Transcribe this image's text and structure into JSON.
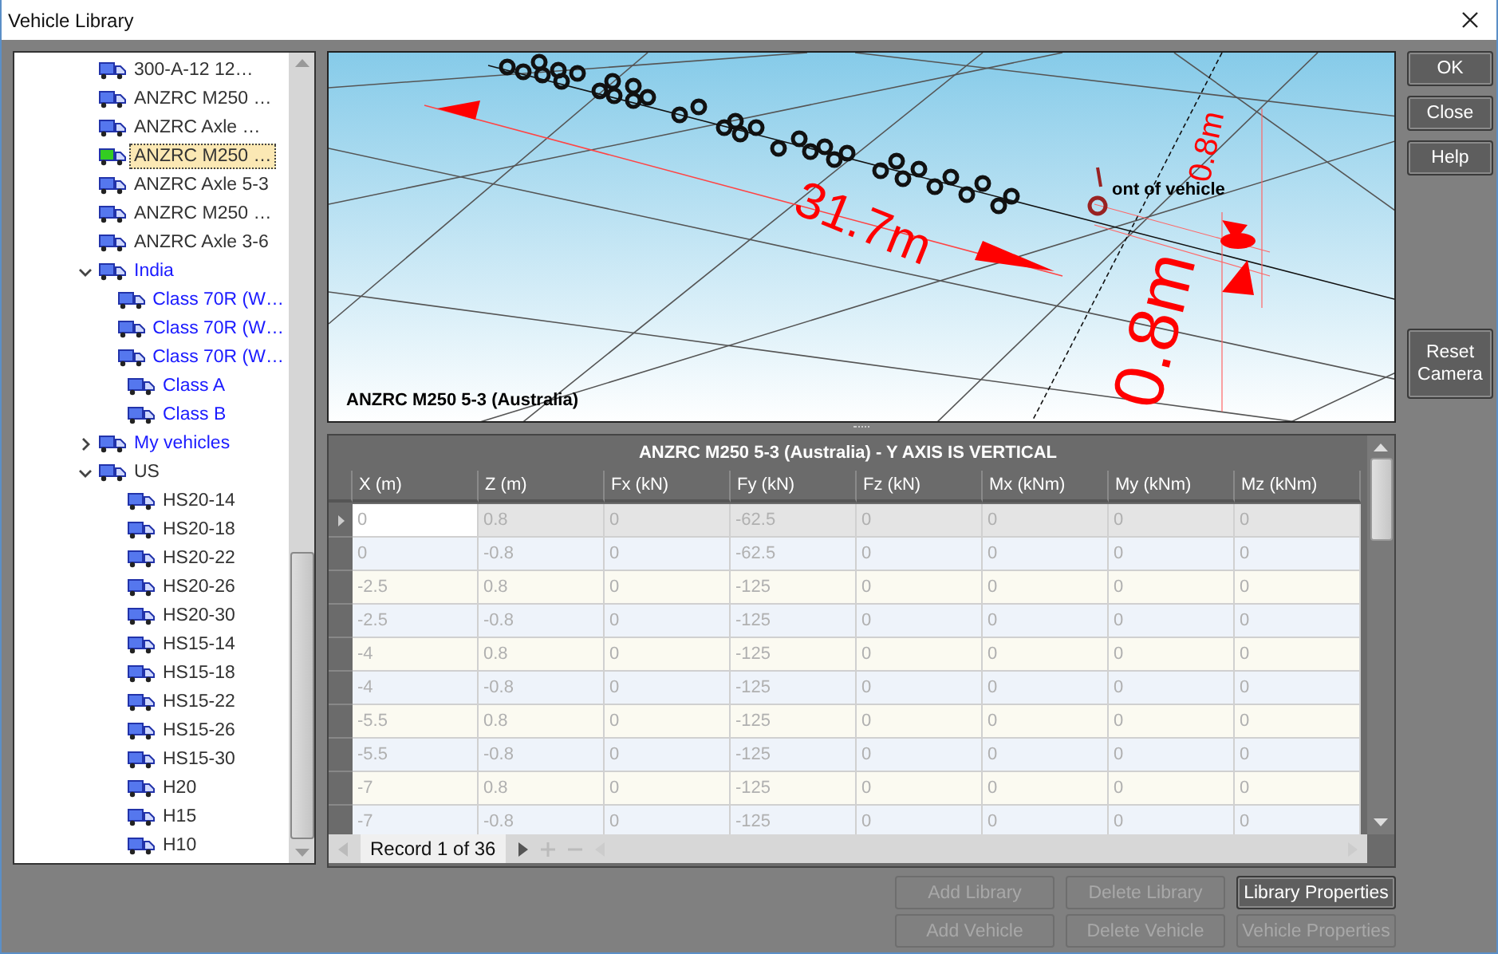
{
  "window": {
    "title": "Vehicle Library"
  },
  "tree": {
    "items": [
      {
        "kind": "group",
        "color": "#333333",
        "children": [
          {
            "kind": "vehicle",
            "label": "300-A-12 12…",
            "selected": false
          },
          {
            "kind": "vehicle",
            "label": "ANZRC M250 …",
            "selected": false
          },
          {
            "kind": "vehicle",
            "label": "ANZRC Axle …",
            "selected": false
          },
          {
            "kind": "vehicle",
            "label": "ANZRC M250 …",
            "selected": true
          },
          {
            "kind": "vehicle",
            "label": "ANZRC Axle 5-3",
            "selected": false
          },
          {
            "kind": "vehicle",
            "label": "ANZRC M250 …",
            "selected": false
          },
          {
            "kind": "vehicle",
            "label": "ANZRC Axle 3-6",
            "selected": false
          }
        ]
      },
      {
        "kind": "group",
        "label": "India",
        "color": "#1a1aff",
        "expanded": true,
        "children": [
          {
            "kind": "vehicle",
            "label": "Class 70R (W…",
            "selected": false
          },
          {
            "kind": "vehicle",
            "label": "Class 70R (W…",
            "selected": false
          },
          {
            "kind": "vehicle",
            "label": "Class 70R (W…",
            "selected": false
          },
          {
            "kind": "vehicle",
            "label": "Class A",
            "selected": false
          },
          {
            "kind": "vehicle",
            "label": "Class B",
            "selected": false
          }
        ]
      },
      {
        "kind": "group",
        "label": "My vehicles",
        "color": "#1a1aff",
        "expanded": false
      },
      {
        "kind": "group",
        "label": "US",
        "color": "#333333",
        "expanded": true,
        "children": [
          {
            "kind": "vehicle",
            "label": "HS20-14",
            "selected": false
          },
          {
            "kind": "vehicle",
            "label": "HS20-18",
            "selected": false
          },
          {
            "kind": "vehicle",
            "label": "HS20-22",
            "selected": false
          },
          {
            "kind": "vehicle",
            "label": "HS20-26",
            "selected": false
          },
          {
            "kind": "vehicle",
            "label": "HS20-30",
            "selected": false
          },
          {
            "kind": "vehicle",
            "label": "HS15-14",
            "selected": false
          },
          {
            "kind": "vehicle",
            "label": "HS15-18",
            "selected": false
          },
          {
            "kind": "vehicle",
            "label": "HS15-22",
            "selected": false
          },
          {
            "kind": "vehicle",
            "label": "HS15-26",
            "selected": false
          },
          {
            "kind": "vehicle",
            "label": "HS15-30",
            "selected": false
          },
          {
            "kind": "vehicle",
            "label": "H20",
            "selected": false
          },
          {
            "kind": "vehicle",
            "label": "H15",
            "selected": false
          },
          {
            "kind": "vehicle",
            "label": "H10",
            "selected": false
          }
        ]
      }
    ]
  },
  "viewport": {
    "caption": "ANZRC M250 5-3 (Australia)",
    "length_label": "31.7m",
    "width_labels": [
      "0.8m",
      "0.8m"
    ],
    "marker_label": "ont of vehicle"
  },
  "grid": {
    "title": "ANZRC M250 5-3 (Australia) - Y AXIS IS VERTICAL",
    "columns": [
      "X (m)",
      "Z (m)",
      "Fx (kN)",
      "Fy (kN)",
      "Fz (kN)",
      "Mx (kNm)",
      "My (kNm)",
      "Mz (kNm)"
    ],
    "rows": [
      {
        "selected": true,
        "cells": [
          "0",
          "0.8",
          "0",
          "-62.5",
          "0",
          "0",
          "0",
          "0"
        ]
      },
      {
        "selected": false,
        "cells": [
          "0",
          "-0.8",
          "0",
          "-62.5",
          "0",
          "0",
          "0",
          "0"
        ]
      },
      {
        "selected": false,
        "cells": [
          "-2.5",
          "0.8",
          "0",
          "-125",
          "0",
          "0",
          "0",
          "0"
        ]
      },
      {
        "selected": false,
        "cells": [
          "-2.5",
          "-0.8",
          "0",
          "-125",
          "0",
          "0",
          "0",
          "0"
        ]
      },
      {
        "selected": false,
        "cells": [
          "-4",
          "0.8",
          "0",
          "-125",
          "0",
          "0",
          "0",
          "0"
        ]
      },
      {
        "selected": false,
        "cells": [
          "-4",
          "-0.8",
          "0",
          "-125",
          "0",
          "0",
          "0",
          "0"
        ]
      },
      {
        "selected": false,
        "cells": [
          "-5.5",
          "0.8",
          "0",
          "-125",
          "0",
          "0",
          "0",
          "0"
        ]
      },
      {
        "selected": false,
        "cells": [
          "-5.5",
          "-0.8",
          "0",
          "-125",
          "0",
          "0",
          "0",
          "0"
        ]
      },
      {
        "selected": false,
        "cells": [
          "-7",
          "0.8",
          "0",
          "-125",
          "0",
          "0",
          "0",
          "0"
        ]
      },
      {
        "selected": false,
        "cells": [
          "-7",
          "-0.8",
          "0",
          "-125",
          "0",
          "0",
          "0",
          "0"
        ]
      }
    ],
    "footer": "Record 1 of 36"
  },
  "side_buttons": [
    {
      "label": "OK",
      "disabled": false
    },
    {
      "label": "Close",
      "disabled": false
    },
    {
      "label": "Help",
      "disabled": false
    },
    {
      "label": "Reset Camera",
      "disabled": false
    }
  ],
  "bottom_buttons": [
    [
      {
        "label": "Add Library",
        "disabled": true
      },
      {
        "label": "Delete Library",
        "disabled": true
      },
      {
        "label": "Library Properties",
        "disabled": false
      }
    ],
    [
      {
        "label": "Add Vehicle",
        "disabled": true
      },
      {
        "label": "Delete Vehicle",
        "disabled": true
      },
      {
        "label": "Vehicle Properties",
        "disabled": true
      }
    ]
  ]
}
